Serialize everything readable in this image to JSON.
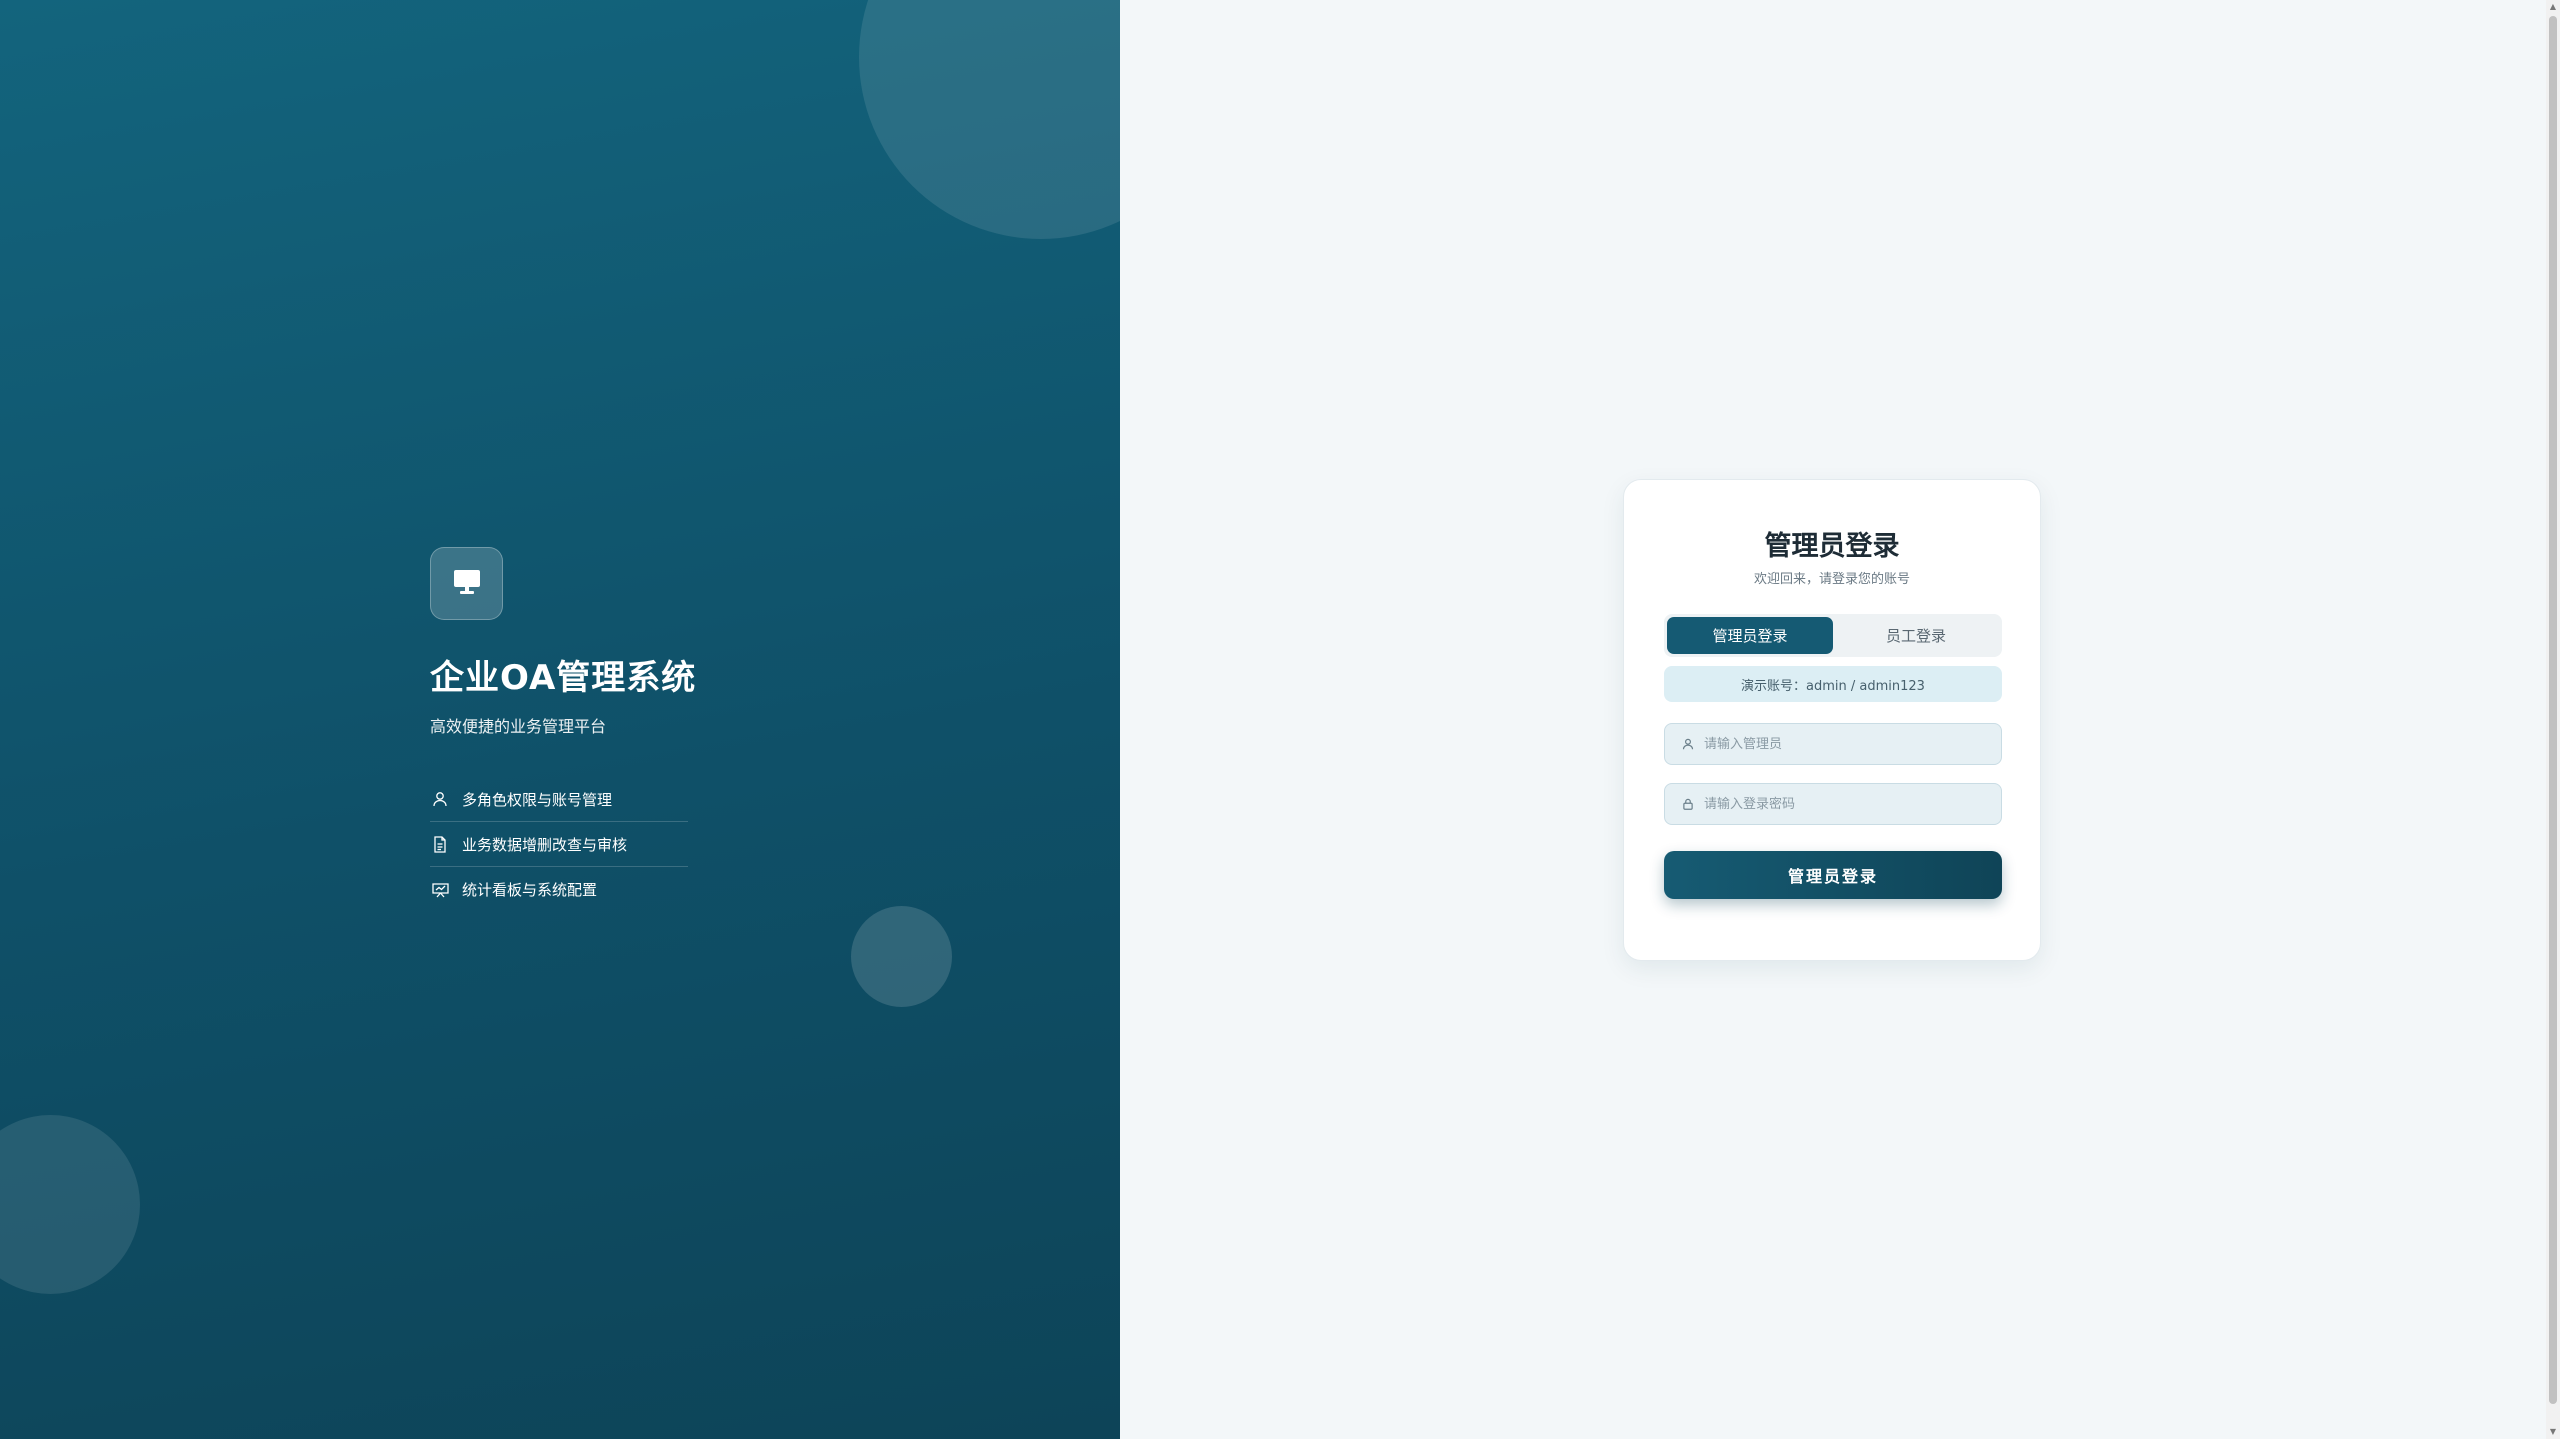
{
  "brand": {
    "logo_icon": "monitor-icon",
    "title": "企业OA管理系统",
    "subtitle": "高效便捷的业务管理平台",
    "features": [
      {
        "icon": "user-icon",
        "label": "多角色权限与账号管理"
      },
      {
        "icon": "document-icon",
        "label": "业务数据增删改查与审核"
      },
      {
        "icon": "chart-board-icon",
        "label": "统计看板与系统配置"
      }
    ],
    "colors": {
      "panel_top": "#13647d",
      "panel_bottom": "#0d4458"
    }
  },
  "login": {
    "title": "管理员登录",
    "subtitle": "欢迎回来，请登录您的账号",
    "tabs": [
      {
        "label": "管理员登录",
        "active": true
      },
      {
        "label": "员工登录",
        "active": false
      }
    ],
    "demo_hint": "演示账号：admin / admin123",
    "username": {
      "icon": "user-icon",
      "placeholder": "请输入管理员",
      "value": ""
    },
    "password": {
      "icon": "lock-icon",
      "placeholder": "请输入登录密码",
      "value": ""
    },
    "submit_label": "管理员登录",
    "colors": {
      "accent": "#155a73",
      "background": "#f3f7f9"
    }
  }
}
